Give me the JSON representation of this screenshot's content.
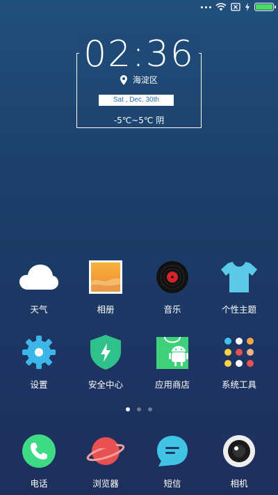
{
  "status_bar": {
    "icons": [
      "more-dots-icon",
      "wifi-icon",
      "sim-none-icon",
      "charging-bolt-icon",
      "battery-icon"
    ],
    "battery_color": "#4cd964"
  },
  "clock_widget": {
    "time": "02:36",
    "location": "海淀区",
    "date": "Sat , Dec. 30th",
    "weather": "-5℃~5℃ 阴"
  },
  "home_apps": [
    {
      "name": "weather",
      "label": "天气",
      "icon": "cloud-icon"
    },
    {
      "name": "gallery",
      "label": "相册",
      "icon": "photo-icon"
    },
    {
      "name": "music",
      "label": "音乐",
      "icon": "vinyl-record-icon"
    },
    {
      "name": "themes",
      "label": "个性主题",
      "icon": "tshirt-icon"
    },
    {
      "name": "settings",
      "label": "设置",
      "icon": "gear-icon"
    },
    {
      "name": "security",
      "label": "安全中心",
      "icon": "shield-bolt-icon"
    },
    {
      "name": "app-store",
      "label": "应用商店",
      "icon": "shopping-bag-android-icon"
    },
    {
      "name": "system-tools",
      "label": "系统工具",
      "icon": "folder-grid-icon"
    }
  ],
  "page_indicator": {
    "count": 3,
    "active_index": 0
  },
  "dock": [
    {
      "name": "phone",
      "label": "电话",
      "icon": "phone-icon"
    },
    {
      "name": "browser",
      "label": "浏览器",
      "icon": "planet-icon"
    },
    {
      "name": "messages",
      "label": "短信",
      "icon": "chat-bubble-icon"
    },
    {
      "name": "camera",
      "label": "相机",
      "icon": "camera-lens-icon"
    }
  ],
  "colors": {
    "phone": "#3ddc84",
    "browser": "#e8514f",
    "messages": "#3fc4e6",
    "settings": "#3cb6e8",
    "security": "#2ec28a",
    "themes": "#5cc9e9",
    "app_store": "#3fd07a"
  }
}
